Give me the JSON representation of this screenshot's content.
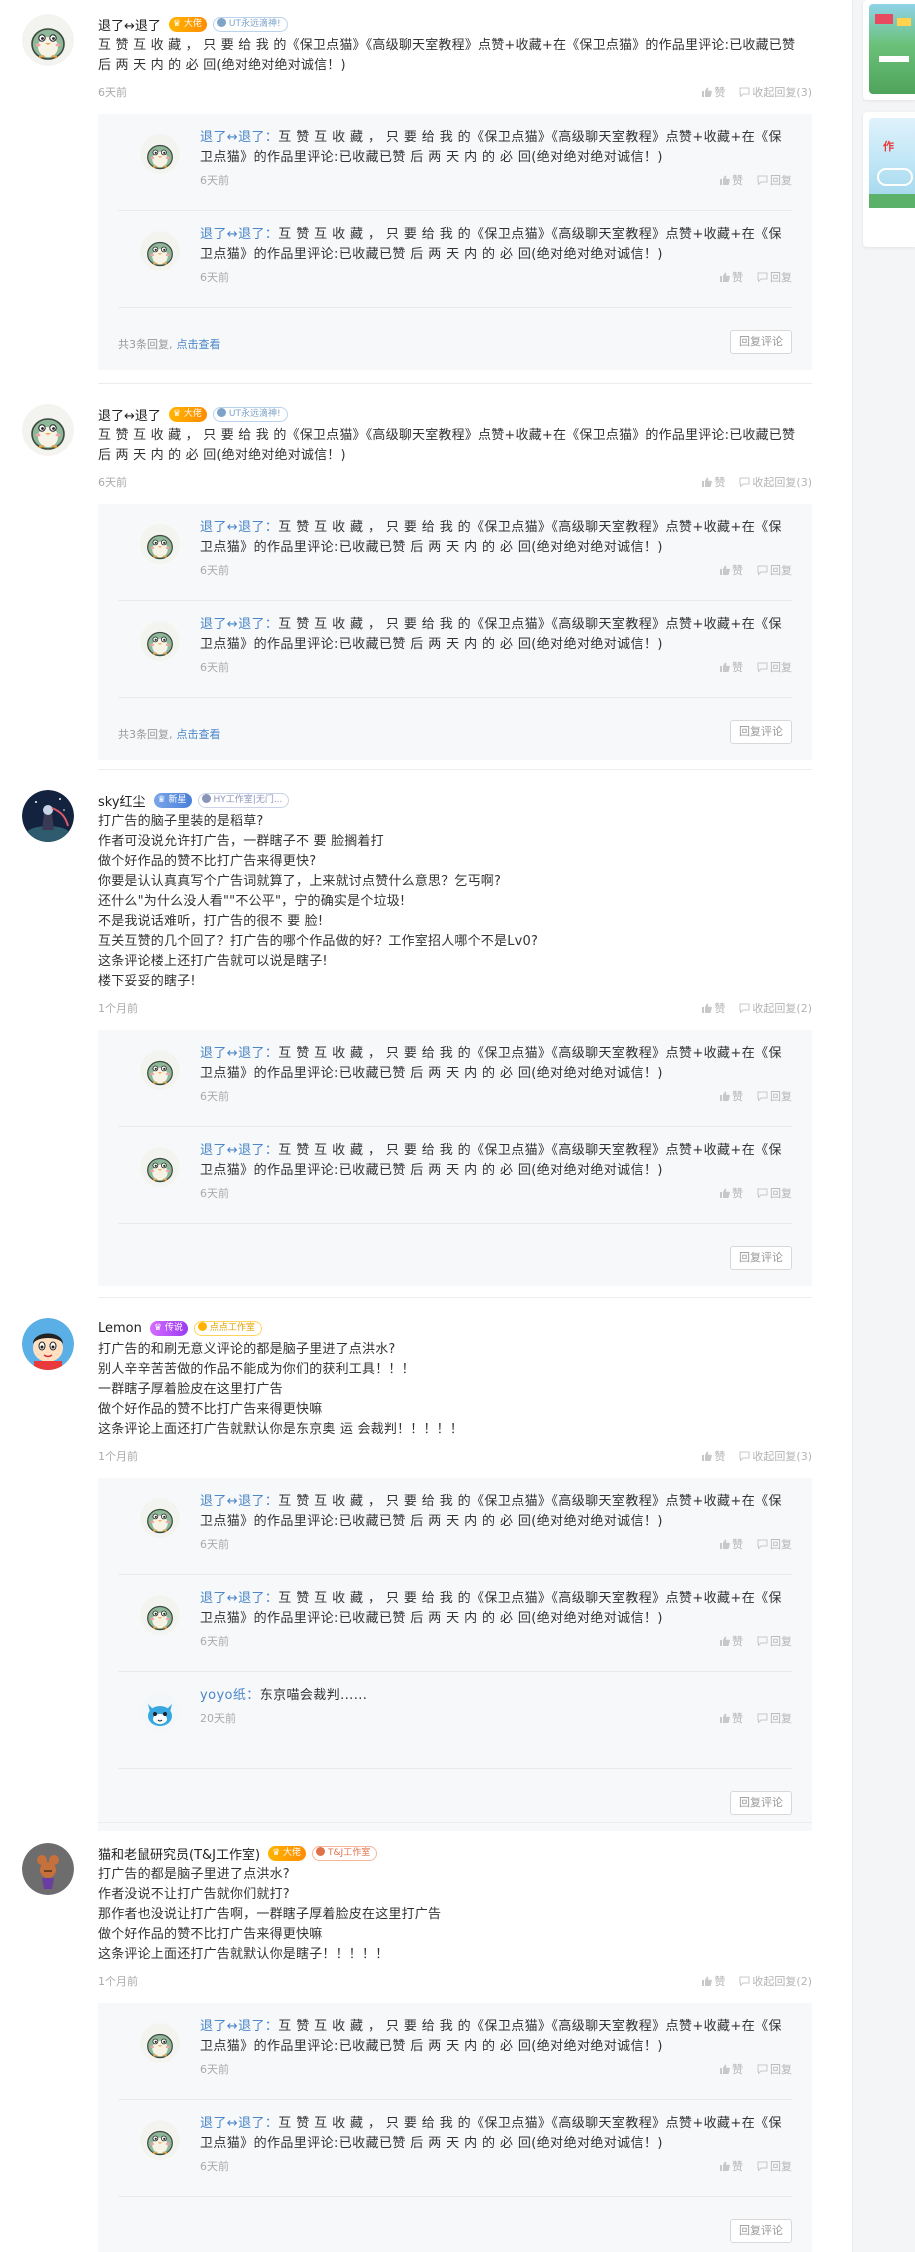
{
  "icons": {
    "like": "thumb-up-icon",
    "reply": "reply-icon"
  },
  "labels": {
    "like": "赞",
    "reply": "回复",
    "reply_comment_btn": "回复评论",
    "click_view": "点击查看"
  },
  "reply_template": {
    "name": "退了↔退了：",
    "text": "互 赞 互 收 藏 ， 只 要 给 我 的《保卫点猫》《高级聊天室教程》点赞+收藏+在《保卫点猫》的作品里评论:已收藏已赞 后 两 天 内 的 必 回(绝对绝对绝对诚信！)"
  },
  "comments": [
    {
      "username": "退了↔退了",
      "level_badge": "大佬",
      "studio_badge": "UT永远滴神!",
      "text": "互 赞 互 收 藏 ， 只 要 给 我 的《保卫点猫》《高级聊天室教程》点赞+收藏+在《保卫点猫》的作品里评论:已收藏已赞   后 两 天 内 的 必 回(绝对绝对绝对诚信！)",
      "time": "6天前",
      "collapse_label": "收起回复(3)",
      "replies": [
        {
          "name": "退了↔退了：",
          "text": "互 赞 互 收 藏 ， 只 要 给 我 的《保卫点猫》《高级聊天室教程》点赞+收藏+在《保卫点猫》的作品里评论:已收藏已赞 后 两 天 内 的 必 回(绝对绝对绝对诚信！)",
          "time": "6天前"
        },
        {
          "name": "退了↔退了：",
          "text": "互 赞 互 收 藏 ， 只 要 给 我 的《保卫点猫》《高级聊天室教程》点赞+收藏+在《保卫点猫》的作品里评论:已收藏已赞 后 两 天 内 的 必 回(绝对绝对绝对诚信！)",
          "time": "6天前"
        }
      ],
      "more_text": "共3条回复,"
    },
    {
      "username": "退了↔退了",
      "level_badge": "大佬",
      "studio_badge": "UT永远滴神!",
      "text": "互 赞 互 收 藏 ， 只 要 给 我 的《保卫点猫》《高级聊天室教程》点赞+收藏+在《保卫点猫》的作品里评论:已收藏已赞   后 两 天 内 的 必 回(绝对绝对绝对诚信！)",
      "time": "6天前",
      "collapse_label": "收起回复(3)",
      "replies": [
        {
          "name": "退了↔退了：",
          "text": "互 赞 互 收 藏 ， 只 要 给 我 的《保卫点猫》《高级聊天室教程》点赞+收藏+在《保卫点猫》的作品里评论:已收藏已赞 后 两 天 内 的 必 回(绝对绝对绝对诚信！)",
          "time": "6天前"
        },
        {
          "name": "退了↔退了：",
          "text": "互 赞 互 收 藏 ， 只 要 给 我 的《保卫点猫》《高级聊天室教程》点赞+收藏+在《保卫点猫》的作品里评论:已收藏已赞 后 两 天 内 的 必 回(绝对绝对绝对诚信！)",
          "time": "6天前"
        }
      ],
      "more_text": "共3条回复,"
    },
    {
      "username": "sky红尘",
      "level_badge": "新星",
      "studio_badge": "HY工作室|无门...",
      "text": "打广告的脑子里装的是稻草?\n作者可没说允许打广告，一群瞎子不 要 脸搁着打\n做个好作品的赞不比打广告来得更快?\n你要是认认真真写个广告词就算了，上来就讨点赞什么意思？乞丐啊?\n还什么\"为什么没人看\"\"不公平\"，宁的确实是个垃圾!\n不是我说话难听，打广告的很不 要 脸!\n互关互赞的几个回了？打广告的哪个作品做的好？工作室招人哪个不是Lv0?\n这条评论楼上还打广告就可以说是瞎子!\n楼下妥妥的瞎子!",
      "time": "1个月前",
      "collapse_label": "收起回复(2)",
      "replies": [
        {
          "name": "退了↔退了：",
          "text": "互 赞 互 收 藏 ， 只 要 给 我 的《保卫点猫》《高级聊天室教程》点赞+收藏+在《保卫点猫》的作品里评论:已收藏已赞 后 两 天 内 的 必 回(绝对绝对绝对诚信！)",
          "time": "6天前"
        },
        {
          "name": "退了↔退了：",
          "text": "互 赞 互 收 藏 ， 只 要 给 我 的《保卫点猫》《高级聊天室教程》点赞+收藏+在《保卫点猫》的作品里评论:已收藏已赞 后 两 天 内 的 必 回(绝对绝对绝对诚信！)",
          "time": "6天前"
        }
      ],
      "more_text": ""
    },
    {
      "username": "Lemon",
      "level_badge": "传说",
      "studio_badge": "点点工作室",
      "text": "打广告的和刷无意义评论的都是脑子里进了点洪水?\n别人辛辛苦苦做的作品不能成为你们的获利工具！！！\n一群瞎子厚着脸皮在这里打广告\n做个好作品的赞不比打广告来得更快嘛\n这条评论上面还打广告就默认你是东京奥 运 会裁判！！！！！",
      "time": "1个月前",
      "collapse_label": "收起回复(3)",
      "replies": [
        {
          "name": "退了↔退了：",
          "text": "互 赞 互 收 藏 ， 只 要 给 我 的《保卫点猫》《高级聊天室教程》点赞+收藏+在《保卫点猫》的作品里评论:已收藏已赞 后 两 天 内 的 必 回(绝对绝对绝对诚信！)",
          "time": "6天前"
        },
        {
          "name": "退了↔退了：",
          "text": "互 赞 互 收 藏 ， 只 要 给 我 的《保卫点猫》《高级聊天室教程》点赞+收藏+在《保卫点猫》的作品里评论:已收藏已赞 后 两 天 内 的 必 回(绝对绝对绝对诚信！)",
          "time": "6天前"
        },
        {
          "name": "yoyo纸：",
          "text": "东京喵会裁判......",
          "time": "20天前"
        }
      ],
      "more_text": ""
    },
    {
      "username": "猫和老鼠研究员(T&J工作室)",
      "level_badge": "大佬",
      "studio_badge": "T&J工作室",
      "text": "打广告的都是脑子里进了点洪水?\n作者没说不让打广告就你们就打?\n那作者也没说让打广告啊，一群瞎子厚着脸皮在这里打广告\n做个好作品的赞不比打广告来得更快嘛\n这条评论上面还打广告就默认你是瞎子！！！！！",
      "time": "1个月前",
      "collapse_label": "收起回复(2)",
      "replies": [
        {
          "name": "退了↔退了：",
          "text": "互 赞 互 收 藏 ， 只 要 给 我 的《保卫点猫》《高级聊天室教程》点赞+收藏+在《保卫点猫》的作品里评论:已收藏已赞 后 两 天 内 的 必 回(绝对绝对绝对诚信！)",
          "time": "6天前"
        },
        {
          "name": "退了↔退了：",
          "text": "互 赞 互 收 藏 ， 只 要 给 我 的《保卫点猫》《高级聊天室教程》点赞+收藏+在《保卫点猫》的作品里评论:已收藏已赞 后 两 天 内 的 必 回(绝对绝对绝对诚信！)",
          "time": "6天前"
        }
      ],
      "more_text": ""
    }
  ],
  "rail": {
    "card2_text": "作"
  },
  "colors": {
    "link": "#4a86c8",
    "reply_bg": "#f7f8fa",
    "gold_badge": "#ffa500",
    "blue_badge": "#4a7fd8",
    "purple_badge": "#9a3cf2"
  }
}
